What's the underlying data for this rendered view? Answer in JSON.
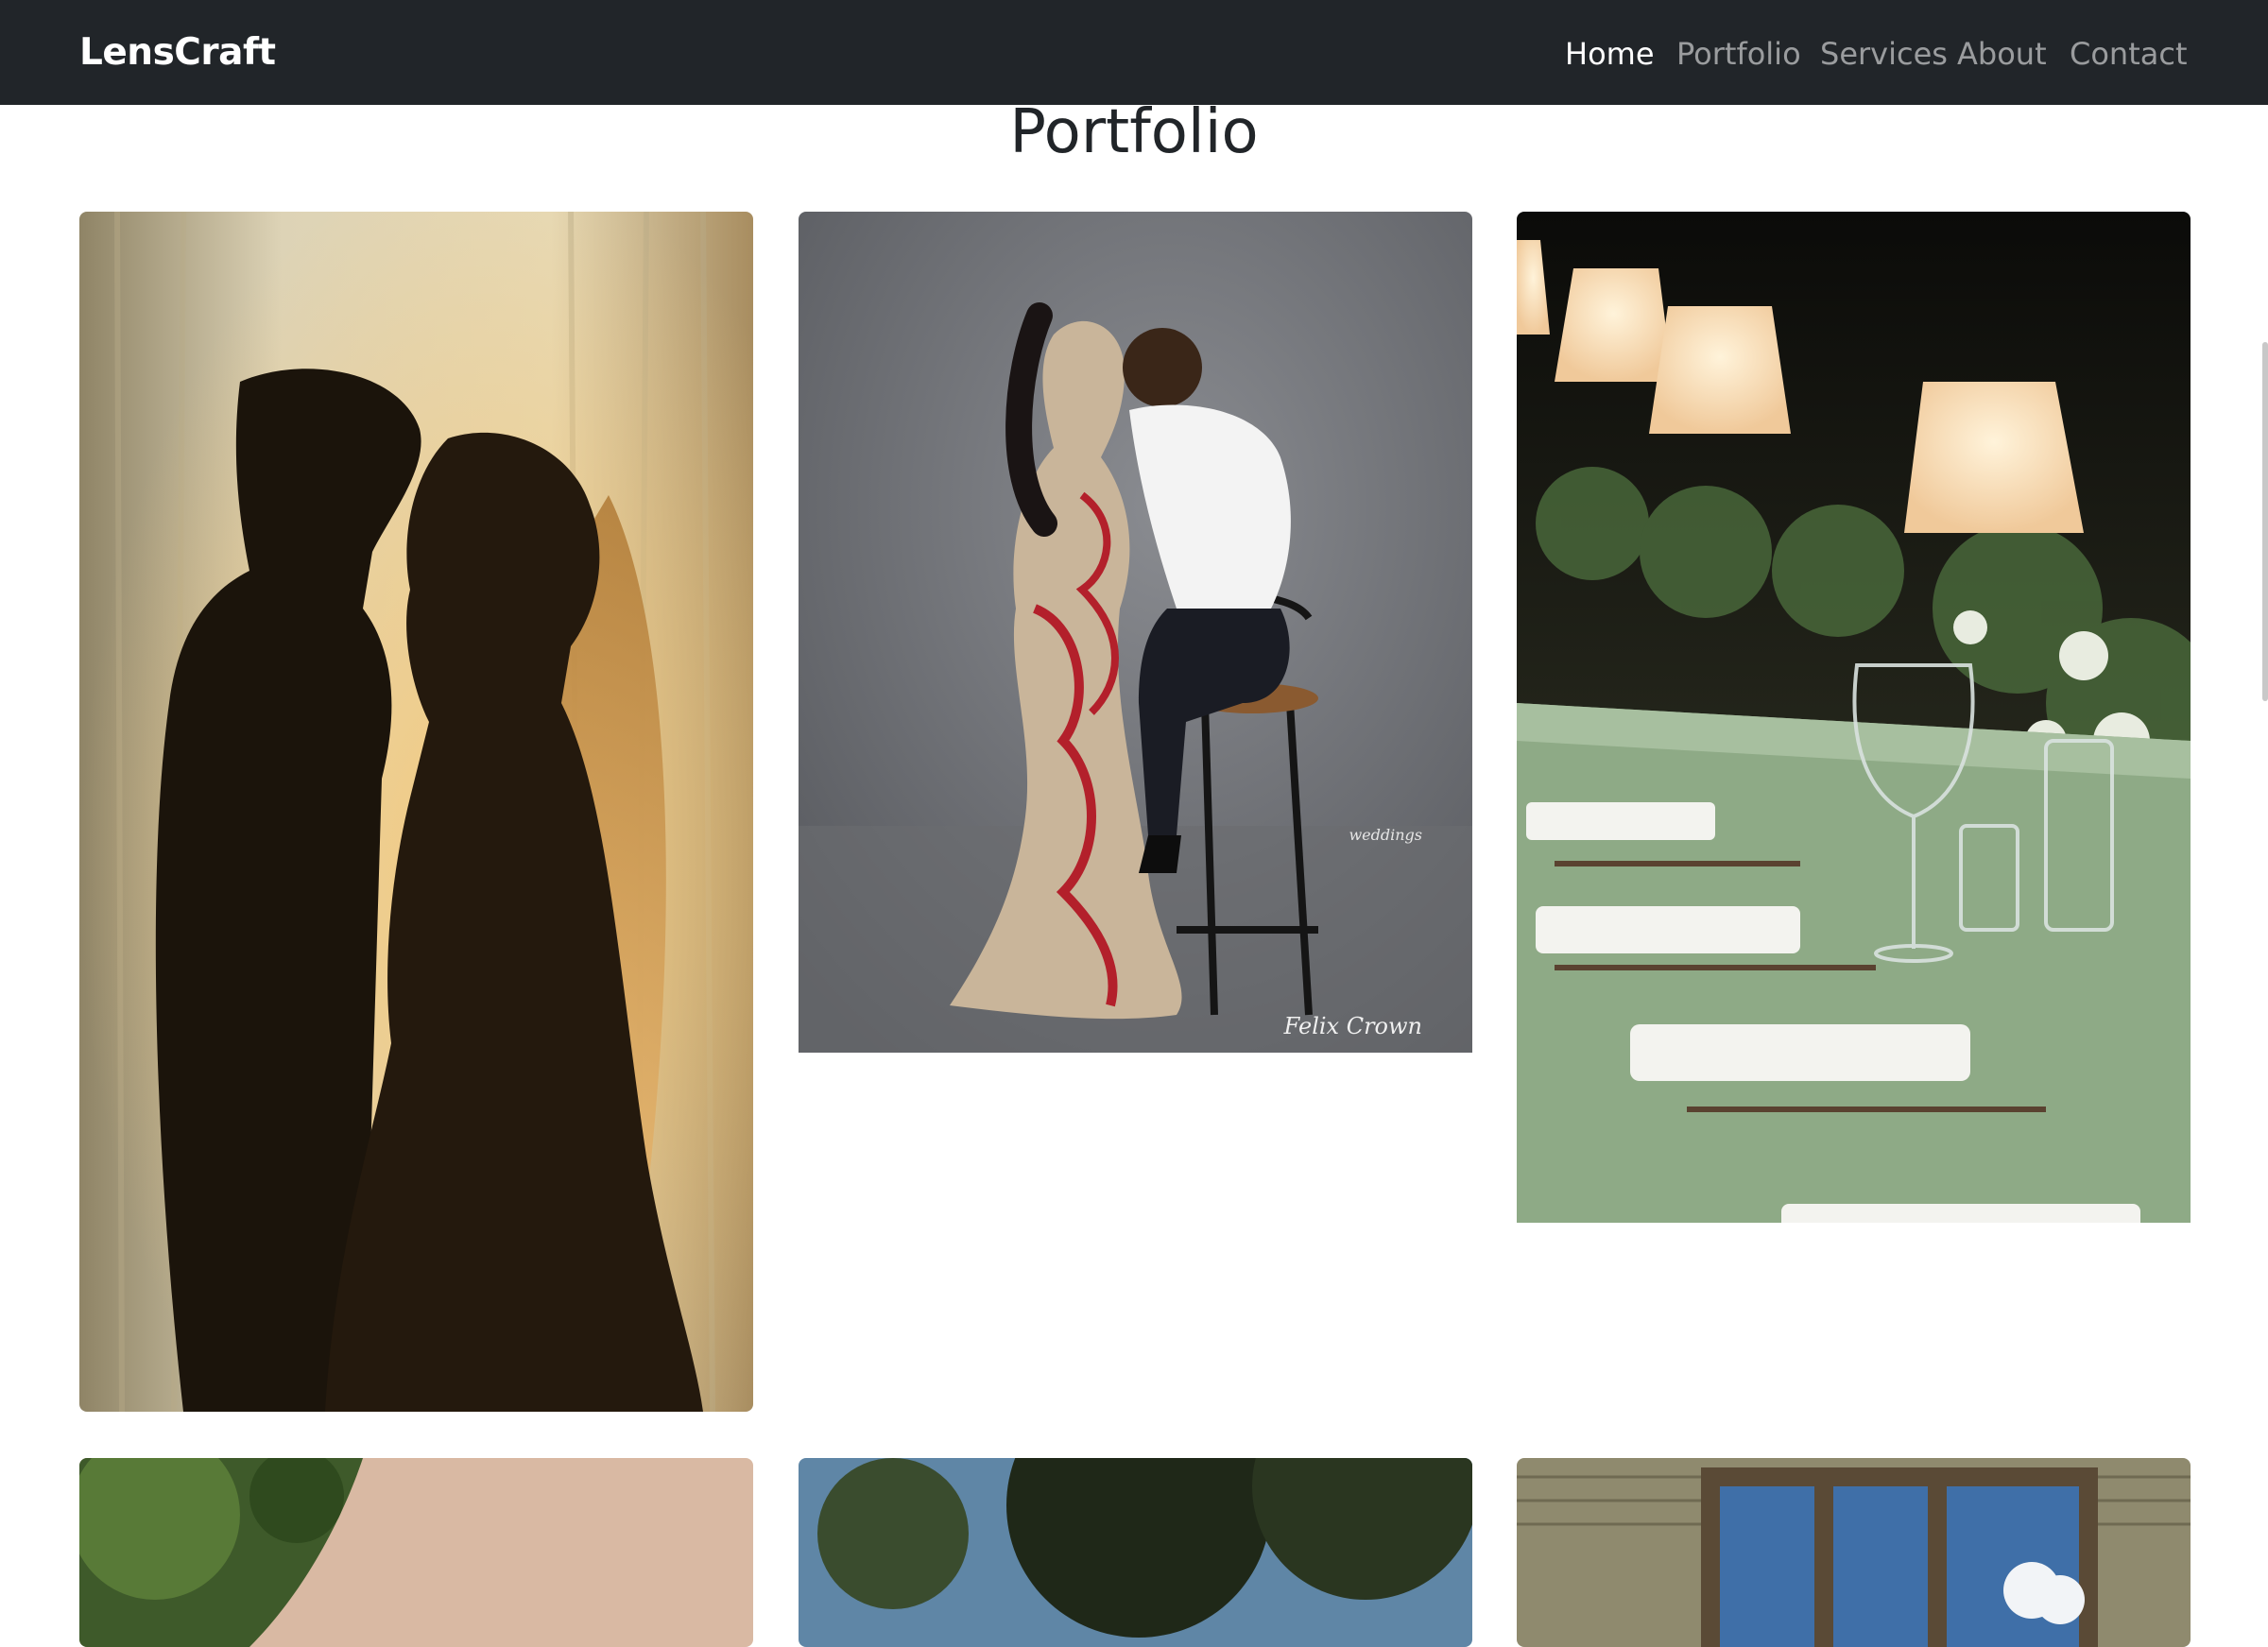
{
  "navbar": {
    "brand": "LensCraft",
    "links": [
      {
        "label": "Home",
        "active": true
      },
      {
        "label": "Portfolio",
        "active": false
      },
      {
        "label": "Services",
        "active": false
      },
      {
        "label": "About",
        "active": false
      },
      {
        "label": "Contact",
        "active": false
      }
    ]
  },
  "page": {
    "title": "Portfolio"
  },
  "gallery": {
    "photos": [
      {
        "subject": "silhouette of bride and groom in front of sheer curtains"
      },
      {
        "subject": "couple posing in studio, man seated on bar stool"
      },
      {
        "subject": "wedding reception table with green linen, glasses and lamps"
      },
      {
        "subject": "outdoor portrait with greenery"
      },
      {
        "subject": "outdoor scene with trees and sky"
      },
      {
        "subject": "building facade with windows"
      }
    ],
    "watermark_text": "Felix Crown",
    "watermark_small": "weddings"
  },
  "colors": {
    "navbar_bg": "#212529",
    "nav_active": "#ffffff",
    "nav_inactive": "rgba(255,255,255,0.55)",
    "page_bg": "#ffffff",
    "heading": "#212529"
  }
}
